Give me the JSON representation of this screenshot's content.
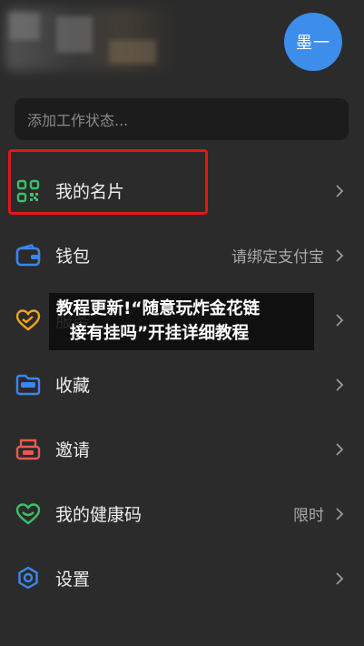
{
  "header": {
    "avatar_text": "墨一"
  },
  "status": {
    "placeholder": "添加工作状态..."
  },
  "menu": [
    {
      "label": "我的名片",
      "right": "",
      "icon": "qr-code-icon"
    },
    {
      "label": "钱包",
      "right": "请绑定支付宝",
      "icon": "wallet-icon"
    },
    {
      "label": "服务",
      "right": "",
      "icon": "service-heart-icon"
    },
    {
      "label": "收藏",
      "right": "",
      "icon": "folder-icon"
    },
    {
      "label": "邀请",
      "right": "",
      "icon": "invite-icon"
    },
    {
      "label": "我的健康码",
      "right": "限时",
      "icon": "health-code-icon"
    },
    {
      "label": "设置",
      "right": "",
      "icon": "settings-gear-icon"
    }
  ],
  "overlay": {
    "line1": "教程更新!“随意玩炸金花链",
    "line2": "接有挂吗”开挂详细教程"
  },
  "colors": {
    "background": "#2b2b2b",
    "avatar": "#3d8eea",
    "highlight_border": "#e01818",
    "wallet": "#3b86f0",
    "service": "#f0a41e",
    "folder": "#3b86f0",
    "invite": "#e65a4f",
    "health": "#3cbf6b",
    "settings": "#3b86f0"
  }
}
